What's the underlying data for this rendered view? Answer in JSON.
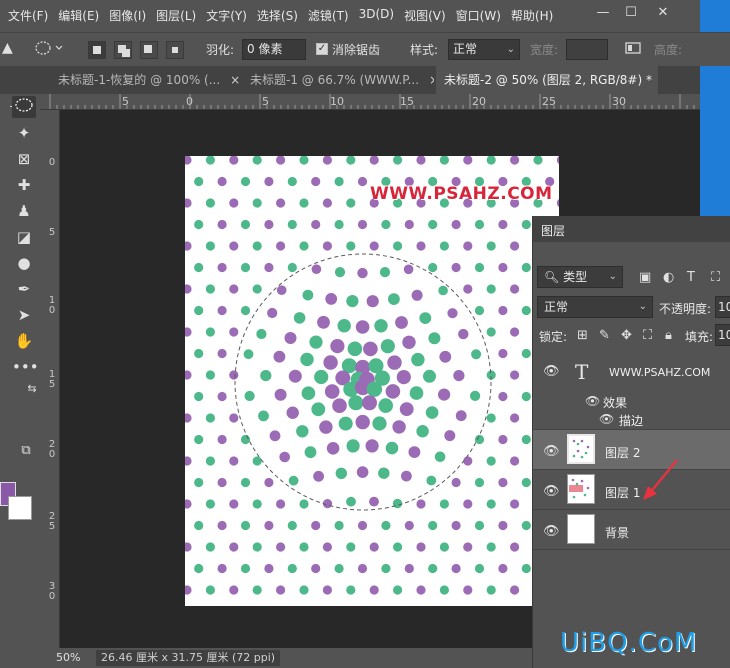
{
  "menu": [
    "文件(F)",
    "编辑(E)",
    "图像(I)",
    "图层(L)",
    "文字(Y)",
    "选择(S)",
    "滤镜(T)",
    "3D(D)",
    "视图(V)",
    "窗口(W)",
    "帮助(H)"
  ],
  "window_controls": {
    "minimize": "—",
    "restore": "☐",
    "close": "✕"
  },
  "options": {
    "feather_label": "羽化:",
    "feather_value": "0 像素",
    "antialias_label": "消除锯齿",
    "style_label": "样式:",
    "style_value": "正常",
    "width_label": "宽度:",
    "height_label": "高度:"
  },
  "tabs": [
    {
      "label": "未标题-1-恢复的 @ 100% (...",
      "close": "×"
    },
    {
      "label": "未标题-1 @ 66.7% (WWW.P...",
      "close": "×"
    },
    {
      "label": "未标题-2 @ 50% (图层 2, RGB/8#) *",
      "close": "×"
    }
  ],
  "ruler_top": [
    "5",
    "0",
    "5",
    "10",
    "15",
    "20",
    "25",
    "30"
  ],
  "ruler_left": [
    "0",
    "5",
    "1 0",
    "1 5",
    "2 0",
    "2 5",
    "3 0"
  ],
  "document": {
    "watermark": "WWW.PSAHZ.COM",
    "colors": {
      "purple": "#9b6bb5",
      "green": "#4db88a",
      "background": "#ffffff"
    }
  },
  "status": {
    "zoom": "50%",
    "dimensions": "26.46 厘米 x 31.75 厘米 (72 ppi)"
  },
  "foreground_color": "#8a59a8",
  "layers_panel": {
    "title": "图层",
    "filter_kind": "类型",
    "blend_mode": "正常",
    "opacity_label": "不透明度:",
    "opacity_value": "10",
    "lock_label": "锁定:",
    "fill_label": "填充:",
    "fill_value": "10",
    "layers": [
      {
        "name": "WWW.PSAHZ.COM",
        "effects_label": "效果",
        "stroke_label": "描边"
      },
      {
        "name": "图层 2"
      },
      {
        "name": "图层 1"
      },
      {
        "name": "背景"
      }
    ]
  },
  "site_watermark": "UiBQ.CoM"
}
